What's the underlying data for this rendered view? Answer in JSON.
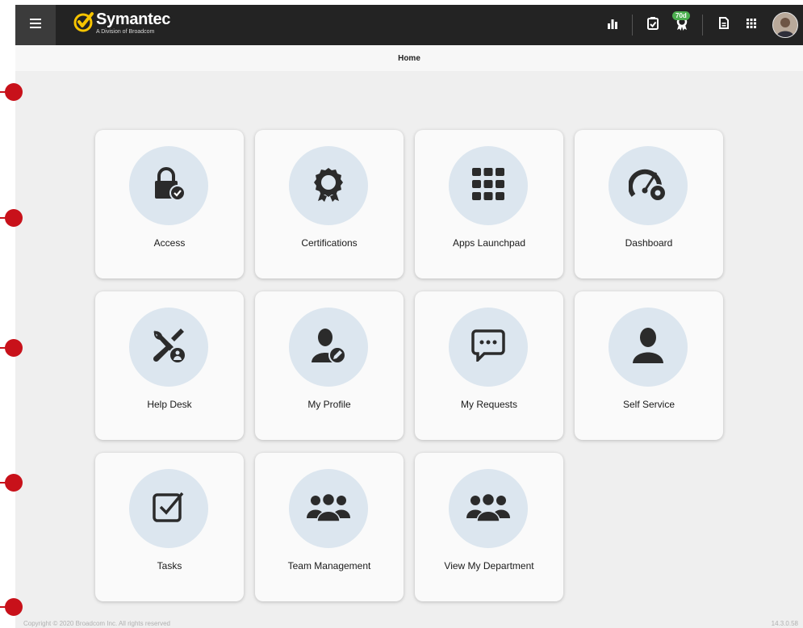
{
  "brand": {
    "name": "Symantec",
    "sub": "A Division of Broadcom",
    "accent": "#f7c400"
  },
  "topbar": {
    "badge": "70d",
    "icons": [
      "menu-icon",
      "bar-chart-icon",
      "clipboard-check-icon",
      "award-icon",
      "document-icon",
      "apps-grid-icon",
      "user-avatar"
    ]
  },
  "breadcrumb": {
    "title": "Home"
  },
  "tiles": [
    {
      "label": "Access",
      "icon": "lock-check-icon"
    },
    {
      "label": "Certifications",
      "icon": "award-icon"
    },
    {
      "label": "Apps Launchpad",
      "icon": "apps-grid-icon"
    },
    {
      "label": "Dashboard",
      "icon": "gauge-gear-icon"
    },
    {
      "label": "Help Desk",
      "icon": "tools-user-icon"
    },
    {
      "label": "My Profile",
      "icon": "user-edit-icon"
    },
    {
      "label": "My Requests",
      "icon": "chat-bubble-icon"
    },
    {
      "label": "Self Service",
      "icon": "user-icon"
    },
    {
      "label": "Tasks",
      "icon": "checkbox-icon"
    },
    {
      "label": "Team Management",
      "icon": "group-icon"
    },
    {
      "label": "View My Department",
      "icon": "group-icon"
    }
  ],
  "footer": {
    "copyright": "Copyright © 2020 Broadcom Inc. All rights reserved",
    "version": "14.3.0.58"
  },
  "colors": {
    "topbar": "#232323",
    "page_bg": "#efefef",
    "tile_bg": "#fafafa",
    "icon_circle": "#dce6ef",
    "marker": "#c8111a"
  }
}
